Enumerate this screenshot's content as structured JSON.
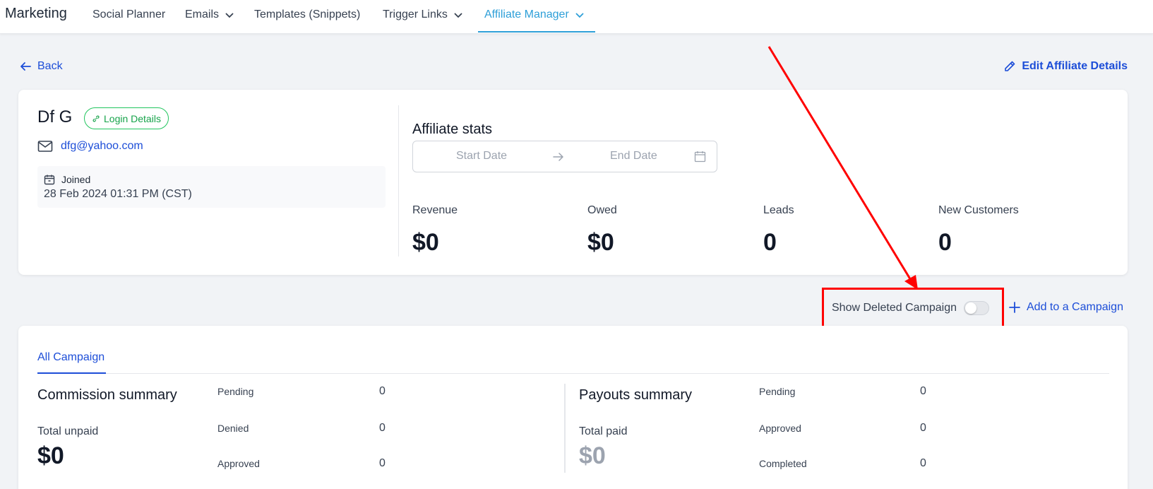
{
  "nav": {
    "brand": "Marketing",
    "items": [
      {
        "label": "Social Planner"
      },
      {
        "label": "Emails"
      },
      {
        "label": "Templates (Snippets)"
      },
      {
        "label": "Trigger Links"
      },
      {
        "label": "Affiliate Manager"
      }
    ]
  },
  "page": {
    "back_label": "Back",
    "edit_label": "Edit Affiliate Details"
  },
  "affiliate": {
    "name": "Df G",
    "login_badge": "Login Details",
    "email": "dfg@yahoo.com",
    "joined_label": "Joined",
    "joined_date": "28 Feb 2024 01:31 PM (CST)"
  },
  "stats": {
    "title": "Affiliate stats",
    "start_placeholder": "Start Date",
    "end_placeholder": "End Date",
    "items": [
      {
        "label": "Revenue",
        "value": "$0"
      },
      {
        "label": "Owed",
        "value": "$0"
      },
      {
        "label": "Leads",
        "value": "0"
      },
      {
        "label": "New Customers",
        "value": "0"
      }
    ]
  },
  "campaign_actions": {
    "show_deleted_label": "Show Deleted Campaign",
    "show_deleted_on": false,
    "add_label": "Add to a Campaign"
  },
  "campaigns": {
    "tab": "All Campaign",
    "commission": {
      "title": "Commission summary",
      "total_label": "Total unpaid",
      "total_value": "$0",
      "rows": [
        {
          "label": "Pending",
          "value": "0"
        },
        {
          "label": "Denied",
          "value": "0"
        },
        {
          "label": "Approved",
          "value": "0"
        }
      ]
    },
    "payouts": {
      "title": "Payouts summary",
      "total_label": "Total paid",
      "total_value": "$0",
      "rows": [
        {
          "label": "Pending",
          "value": "0"
        },
        {
          "label": "Approved",
          "value": "0"
        },
        {
          "label": "Completed",
          "value": "0"
        }
      ]
    }
  },
  "colors": {
    "accent": "#2e9fd8",
    "link": "#1d4ed8",
    "success": "#16a34a",
    "annotation": "#ff0000"
  }
}
